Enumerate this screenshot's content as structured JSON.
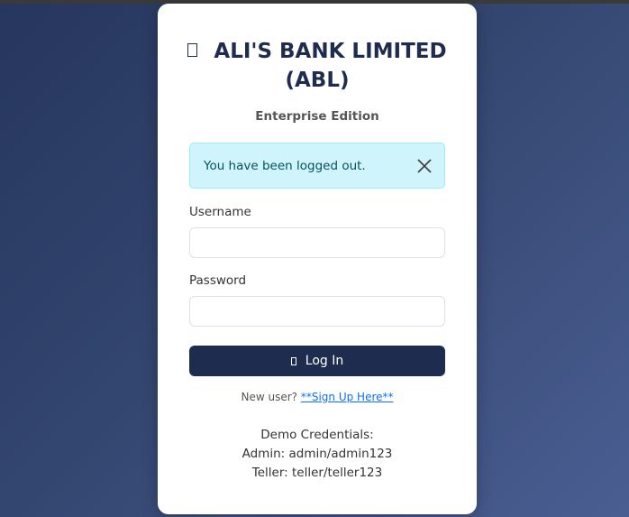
{
  "header": {
    "title": "ALI'S BANK LIMITED (ABL)",
    "subtitle": "Enterprise Edition",
    "icon": "bank-icon"
  },
  "alert": {
    "message": "You have been logged out.",
    "close_icon": "close-icon",
    "colors": {
      "background": "#cff4fc",
      "border": "#9eeaf9",
      "text": "#055160"
    }
  },
  "form": {
    "username_label": "Username",
    "username_value": "",
    "password_label": "Password",
    "password_value": "",
    "login_label": "Log In",
    "login_icon": "login-icon"
  },
  "signup": {
    "prompt": "New user?",
    "link_text": "**Sign Up Here**"
  },
  "demo": {
    "heading": "Demo Credentials:",
    "admin": "Admin: admin/admin123",
    "teller": "Teller: teller/teller123"
  },
  "colors": {
    "primary": "#1e2d4f",
    "background_start": "#26365e",
    "background_end": "#4a5e92",
    "link": "#0d6efd"
  }
}
